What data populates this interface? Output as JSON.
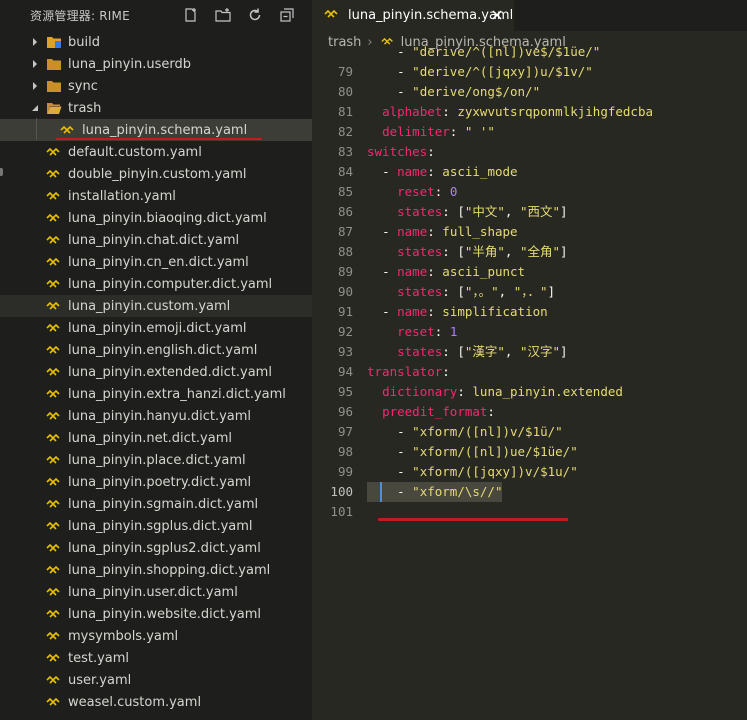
{
  "sidebar": {
    "title": "资源管理器: RIME",
    "actions": [
      {
        "name": "new-file-icon"
      },
      {
        "name": "new-folder-icon"
      },
      {
        "name": "refresh-icon"
      },
      {
        "name": "collapse-all-icon"
      }
    ],
    "folders": [
      {
        "label": "build",
        "expanded": false
      },
      {
        "label": "luna_pinyin.userdb",
        "expanded": false
      },
      {
        "label": "sync",
        "expanded": false
      },
      {
        "label": "trash",
        "expanded": true
      }
    ],
    "trash_children": [
      "luna_pinyin.schema.yaml"
    ],
    "files": [
      "default.custom.yaml",
      "double_pinyin.custom.yaml",
      "installation.yaml",
      "luna_pinyin.biaoqing.dict.yaml",
      "luna_pinyin.chat.dict.yaml",
      "luna_pinyin.cn_en.dict.yaml",
      "luna_pinyin.computer.dict.yaml",
      "luna_pinyin.custom.yaml",
      "luna_pinyin.emoji.dict.yaml",
      "luna_pinyin.english.dict.yaml",
      "luna_pinyin.extended.dict.yaml",
      "luna_pinyin.extra_hanzi.dict.yaml",
      "luna_pinyin.hanyu.dict.yaml",
      "luna_pinyin.net.dict.yaml",
      "luna_pinyin.place.dict.yaml",
      "luna_pinyin.poetry.dict.yaml",
      "luna_pinyin.sgmain.dict.yaml",
      "luna_pinyin.sgplus.dict.yaml",
      "luna_pinyin.sgplus2.dict.yaml",
      "luna_pinyin.shopping.dict.yaml",
      "luna_pinyin.user.dict.yaml",
      "luna_pinyin.website.dict.yaml",
      "mysymbols.yaml",
      "test.yaml",
      "user.yaml",
      "weasel.custom.yaml"
    ]
  },
  "editor": {
    "tab_label": "luna_pinyin.schema.yaml",
    "breadcrumb": [
      "trash",
      "luna_pinyin.schema.yaml"
    ],
    "current_line": 100,
    "lines": [
      {
        "n": "79",
        "i": 4,
        "tokens": [
          [
            "p",
            "- "
          ],
          [
            "s",
            "\"derive/^([jqxy])u/$1v/\""
          ]
        ]
      },
      {
        "n": "80",
        "i": 4,
        "tokens": [
          [
            "p",
            "- "
          ],
          [
            "s",
            "\"derive/ong$/on/\""
          ]
        ]
      },
      {
        "n": "81",
        "i": 2,
        "tokens": [
          [
            "k",
            "alphabet"
          ],
          [
            "p",
            ": "
          ],
          [
            "s",
            "zyxwvutsrqponmlkjihgfedcba"
          ]
        ]
      },
      {
        "n": "82",
        "i": 2,
        "tokens": [
          [
            "k",
            "delimiter"
          ],
          [
            "p",
            ": "
          ],
          [
            "s",
            "\" '\""
          ]
        ]
      },
      {
        "n": "83",
        "i": 0,
        "tokens": [
          [
            "k",
            "switches"
          ],
          [
            "p",
            ":"
          ]
        ]
      },
      {
        "n": "84",
        "i": 2,
        "tokens": [
          [
            "p",
            "- "
          ],
          [
            "k",
            "name"
          ],
          [
            "p",
            ": "
          ],
          [
            "s",
            "ascii_mode"
          ]
        ]
      },
      {
        "n": "85",
        "i": 4,
        "tokens": [
          [
            "k",
            "reset"
          ],
          [
            "p",
            ": "
          ],
          [
            "n",
            "0"
          ]
        ]
      },
      {
        "n": "86",
        "i": 4,
        "tokens": [
          [
            "k",
            "states"
          ],
          [
            "p",
            ": ["
          ],
          [
            "s",
            "\"中文\""
          ],
          [
            "p",
            ", "
          ],
          [
            "s",
            "\"西文\""
          ],
          [
            "p",
            "]"
          ]
        ]
      },
      {
        "n": "87",
        "i": 2,
        "tokens": [
          [
            "p",
            "- "
          ],
          [
            "k",
            "name"
          ],
          [
            "p",
            ": "
          ],
          [
            "s",
            "full_shape"
          ]
        ]
      },
      {
        "n": "88",
        "i": 4,
        "tokens": [
          [
            "k",
            "states"
          ],
          [
            "p",
            ": ["
          ],
          [
            "s",
            "\"半角\""
          ],
          [
            "p",
            ", "
          ],
          [
            "s",
            "\"全角\""
          ],
          [
            "p",
            "]"
          ]
        ]
      },
      {
        "n": "89",
        "i": 2,
        "tokens": [
          [
            "p",
            "- "
          ],
          [
            "k",
            "name"
          ],
          [
            "p",
            ": "
          ],
          [
            "s",
            "ascii_punct"
          ]
        ]
      },
      {
        "n": "90",
        "i": 4,
        "tokens": [
          [
            "k",
            "states"
          ],
          [
            "p",
            ": ["
          ],
          [
            "s",
            "\"，。\""
          ],
          [
            "p",
            ", "
          ],
          [
            "s",
            "\"，．\""
          ],
          [
            "p",
            "]"
          ]
        ]
      },
      {
        "n": "91",
        "i": 2,
        "tokens": [
          [
            "p",
            "- "
          ],
          [
            "k",
            "name"
          ],
          [
            "p",
            ": "
          ],
          [
            "s",
            "simplification"
          ]
        ]
      },
      {
        "n": "92",
        "i": 4,
        "tokens": [
          [
            "k",
            "reset"
          ],
          [
            "p",
            ": "
          ],
          [
            "n",
            "1"
          ]
        ]
      },
      {
        "n": "93",
        "i": 4,
        "tokens": [
          [
            "k",
            "states"
          ],
          [
            "p",
            ": ["
          ],
          [
            "s",
            "\"漢字\""
          ],
          [
            "p",
            ", "
          ],
          [
            "s",
            "\"汉字\""
          ],
          [
            "p",
            "]"
          ]
        ]
      },
      {
        "n": "94",
        "i": 0,
        "tokens": [
          [
            "k",
            "translator"
          ],
          [
            "p",
            ":"
          ]
        ]
      },
      {
        "n": "95",
        "i": 2,
        "tokens": [
          [
            "k",
            "dictionary"
          ],
          [
            "p",
            ": "
          ],
          [
            "s",
            "luna_pinyin.extended"
          ]
        ]
      },
      {
        "n": "96",
        "i": 2,
        "tokens": [
          [
            "k",
            "preedit_format"
          ],
          [
            "p",
            ":"
          ]
        ]
      },
      {
        "n": "97",
        "i": 4,
        "tokens": [
          [
            "p",
            "- "
          ],
          [
            "s",
            "\"xform/([nl])v/$1ü/\""
          ]
        ]
      },
      {
        "n": "98",
        "i": 4,
        "tokens": [
          [
            "p",
            "- "
          ],
          [
            "s",
            "\"xform/([nl])ue/$1üe/\""
          ]
        ]
      },
      {
        "n": "99",
        "i": 4,
        "tokens": [
          [
            "p",
            "- "
          ],
          [
            "s",
            "\"xform/([jqxy])v/$1u/\""
          ]
        ]
      },
      {
        "n": "100",
        "i": 4,
        "tokens": [
          [
            "p",
            "- "
          ],
          [
            "s",
            "\"xform/\\s//\""
          ]
        ]
      },
      {
        "n": "101",
        "i": 0,
        "tokens": []
      }
    ],
    "partial_top_line": "\"derive/^([nl])ve$/$1üe/\""
  },
  "colors": {
    "keyword": "#f92672",
    "string": "#e6db74",
    "number": "#ae81ff",
    "yaml_icon": "#e8c000",
    "annotation_red": "#c21d1d"
  }
}
